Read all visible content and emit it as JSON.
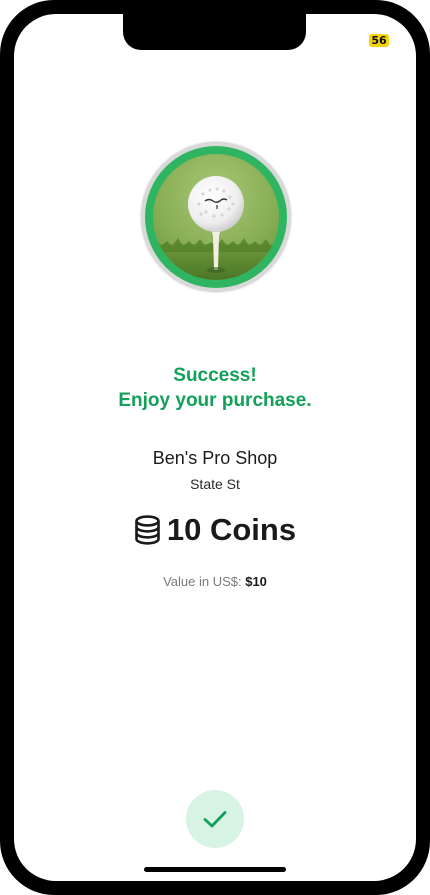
{
  "status_bar": {
    "badge": "56",
    "badge_color": "#f5d20b"
  },
  "product": {
    "image_icon": "golf-ball-on-tee-image",
    "ring_color": "#2fb561"
  },
  "success": {
    "line1": "Success!",
    "line2": "Enjoy your purchase.",
    "color": "#13a05a"
  },
  "shop": {
    "name": "Ben's Pro Shop",
    "location": "State St"
  },
  "amount": {
    "icon": "coins-stack-icon",
    "text": "10 Coins"
  },
  "value": {
    "label": "Value in US$:",
    "amount": "$10"
  },
  "confirm": {
    "icon": "checkmark-icon",
    "color": "#13a05a",
    "background": "#d7f3e3"
  }
}
